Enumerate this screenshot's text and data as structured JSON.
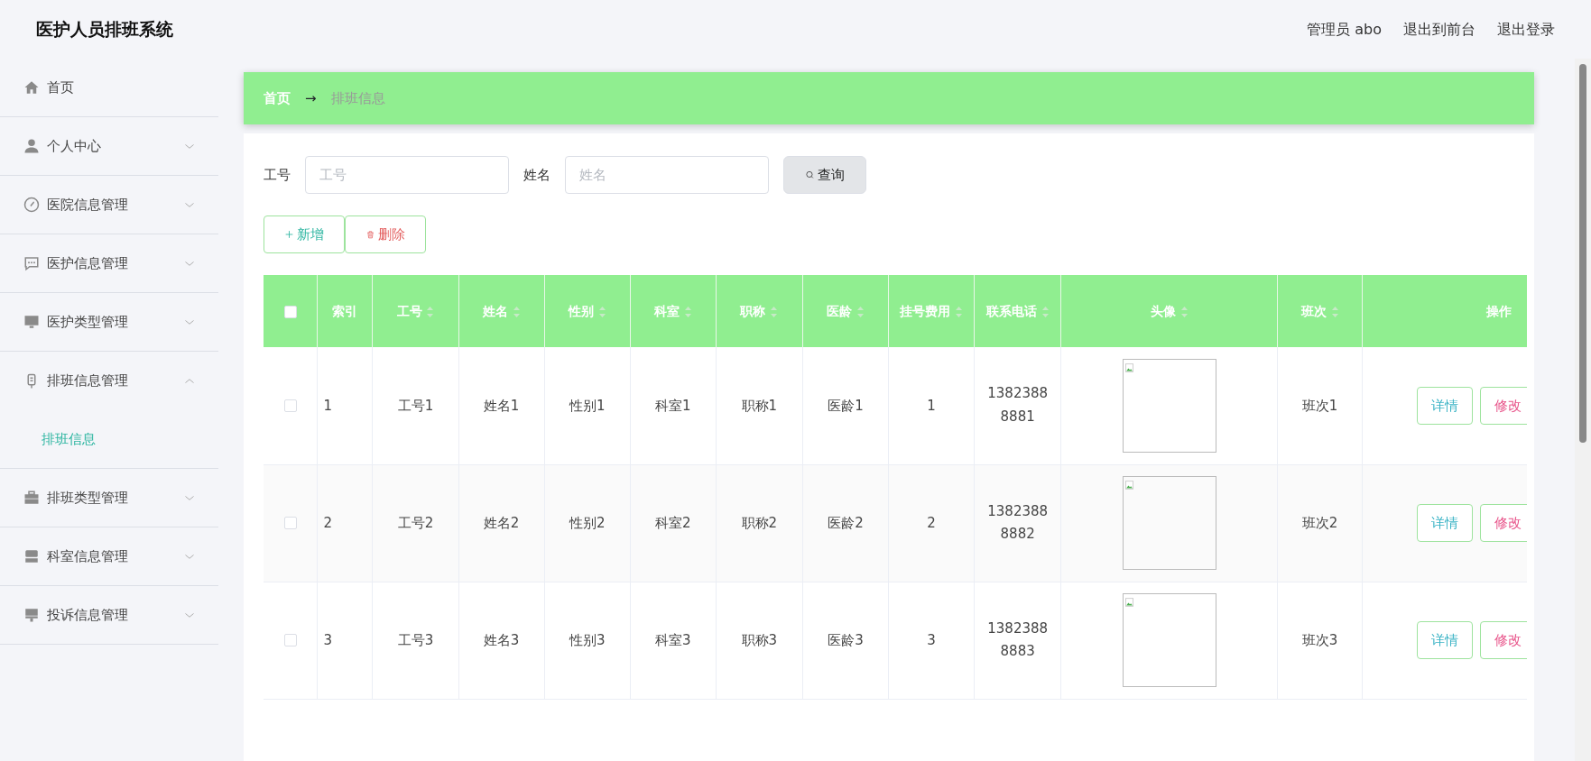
{
  "header": {
    "title": "医护人员排班系统",
    "links": [
      "管理员 abo",
      "退出到前台",
      "退出登录"
    ]
  },
  "sidebar": {
    "items": [
      {
        "label": "首页"
      },
      {
        "label": "个人中心",
        "expanded": false
      },
      {
        "label": "医院信息管理",
        "expanded": false
      },
      {
        "label": "医护信息管理",
        "expanded": false
      },
      {
        "label": "医护类型管理",
        "expanded": false
      },
      {
        "label": "排班信息管理",
        "expanded": true,
        "children": [
          {
            "label": "排班信息",
            "selected": true
          }
        ]
      },
      {
        "label": "排班类型管理",
        "expanded": false
      },
      {
        "label": "科室信息管理",
        "expanded": false
      },
      {
        "label": "投诉信息管理",
        "expanded": false
      }
    ]
  },
  "breadcrumb": {
    "items": [
      "首页",
      "排班信息"
    ],
    "separator": "→"
  },
  "search": {
    "fields": [
      {
        "label": "工号",
        "placeholder": "工号"
      },
      {
        "label": "姓名",
        "placeholder": "姓名"
      }
    ],
    "button": "查询"
  },
  "actions": [
    {
      "kind": "add",
      "label": "新增"
    },
    {
      "kind": "delete",
      "label": "删除"
    }
  ],
  "table": {
    "select_all": {
      "checked": false
    },
    "columns": [
      {
        "label": "索引",
        "sortable": false
      },
      {
        "label": "工号",
        "sortable": true
      },
      {
        "label": "姓名",
        "sortable": true
      },
      {
        "label": "性别",
        "sortable": true
      },
      {
        "label": "科室",
        "sortable": true
      },
      {
        "label": "职称",
        "sortable": true
      },
      {
        "label": "医龄",
        "sortable": true
      },
      {
        "label": "挂号费用",
        "sortable": true
      },
      {
        "label": "联系电话",
        "sortable": true
      },
      {
        "label": "头像",
        "sortable": true
      },
      {
        "label": "班次",
        "sortable": true
      },
      {
        "label": "操作",
        "sortable": false
      }
    ],
    "rows": [
      {
        "checked": false,
        "cells": [
          "1",
          "工号1",
          "姓名1",
          "性别1",
          "科室1",
          "职称1",
          "医龄1",
          "1",
          "13823888881"
        ],
        "shift": "班次1",
        "buttons": [
          "详情",
          "修改"
        ]
      },
      {
        "checked": false,
        "cells": [
          "2",
          "工号2",
          "姓名2",
          "性别2",
          "科室2",
          "职称2",
          "医龄2",
          "2",
          "13823888882"
        ],
        "shift": "班次2",
        "buttons": [
          "详情",
          "修改"
        ]
      },
      {
        "checked": false,
        "cells": [
          "3",
          "工号3",
          "姓名3",
          "性别3",
          "科室3",
          "职称3",
          "医龄3",
          "3",
          "13823888883"
        ],
        "shift": "班次3",
        "buttons": [
          "详情",
          "修改"
        ]
      }
    ]
  }
}
